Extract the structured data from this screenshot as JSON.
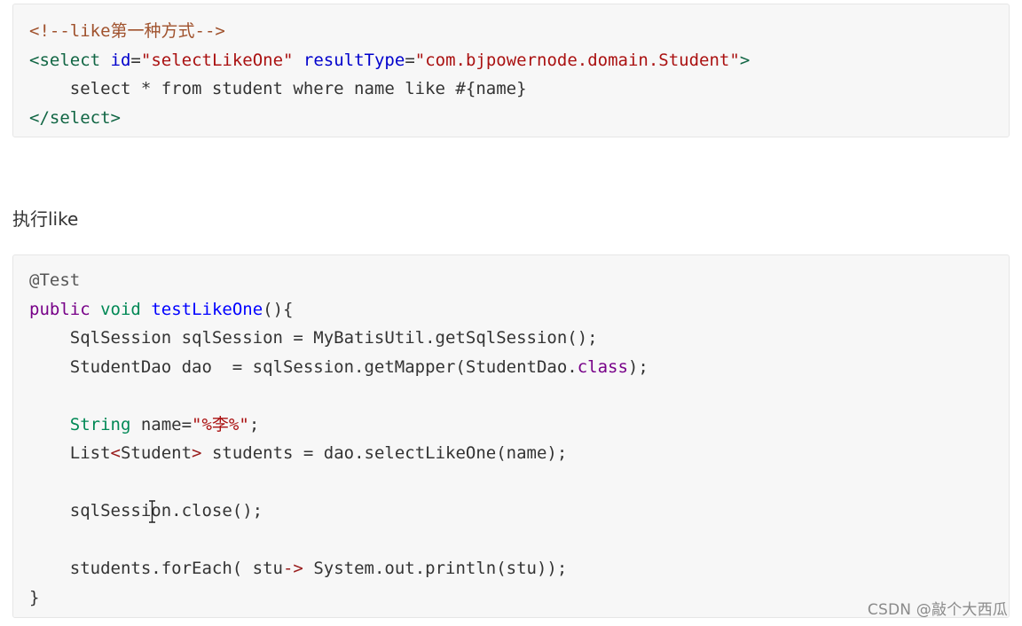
{
  "block1": {
    "lines": [
      [
        {
          "t": "<!--like第一种方式-->",
          "c": "c-comment"
        }
      ],
      [
        {
          "t": "<select",
          "c": "c-tag"
        },
        {
          "t": " ",
          "c": "c-plain"
        },
        {
          "t": "id",
          "c": "c-attr"
        },
        {
          "t": "=",
          "c": "c-plain"
        },
        {
          "t": "\"selectLikeOne\"",
          "c": "c-string"
        },
        {
          "t": " ",
          "c": "c-plain"
        },
        {
          "t": "resultType",
          "c": "c-attr"
        },
        {
          "t": "=",
          "c": "c-plain"
        },
        {
          "t": "\"com.bjpowernode.domain.Student\"",
          "c": "c-string"
        },
        {
          "t": ">",
          "c": "c-tag"
        }
      ],
      [
        {
          "t": "    select * from student where name like #{name}",
          "c": "c-plain"
        }
      ],
      [
        {
          "t": "</select>",
          "c": "c-tag"
        }
      ]
    ]
  },
  "heading": "执行like",
  "block2": {
    "lines": [
      [
        {
          "t": "@Test",
          "c": "c-ann"
        }
      ],
      [
        {
          "t": "public",
          "c": "c-kw"
        },
        {
          "t": " ",
          "c": "c-plain"
        },
        {
          "t": "void",
          "c": "c-type"
        },
        {
          "t": " ",
          "c": "c-plain"
        },
        {
          "t": "testLikeOne",
          "c": "c-def"
        },
        {
          "t": "(){",
          "c": "c-plain"
        }
      ],
      [
        {
          "t": "    SqlSession sqlSession = MyBatisUtil.getSqlSession();",
          "c": "c-plain"
        }
      ],
      [
        {
          "t": "    StudentDao dao  = sqlSession.getMapper(StudentDao.",
          "c": "c-plain"
        },
        {
          "t": "class",
          "c": "c-kw"
        },
        {
          "t": ");",
          "c": "c-plain"
        }
      ],
      [
        {
          "t": "",
          "c": "c-plain"
        }
      ],
      [
        {
          "t": "    ",
          "c": "c-plain"
        },
        {
          "t": "String",
          "c": "c-type"
        },
        {
          "t": " name=",
          "c": "c-plain"
        },
        {
          "t": "\"%李%\"",
          "c": "c-string"
        },
        {
          "t": ";",
          "c": "c-plain"
        }
      ],
      [
        {
          "t": "    List",
          "c": "c-plain"
        },
        {
          "t": "<",
          "c": "c-op"
        },
        {
          "t": "Student",
          "c": "c-plain"
        },
        {
          "t": ">",
          "c": "c-op"
        },
        {
          "t": " students = dao.selectLikeOne(name);",
          "c": "c-plain"
        }
      ],
      [
        {
          "t": "",
          "c": "c-plain"
        }
      ],
      [
        {
          "t": "    sqlSession.close();",
          "c": "c-plain",
          "cursor": true
        }
      ],
      [
        {
          "t": "",
          "c": "c-plain"
        }
      ],
      [
        {
          "t": "    students.forEach( stu",
          "c": "c-plain"
        },
        {
          "t": "->",
          "c": "c-op"
        },
        {
          "t": " System.out.println(stu));",
          "c": "c-plain"
        }
      ],
      [
        {
          "t": "}",
          "c": "c-plain"
        }
      ]
    ]
  },
  "watermark": "CSDN @敲个大西瓜"
}
